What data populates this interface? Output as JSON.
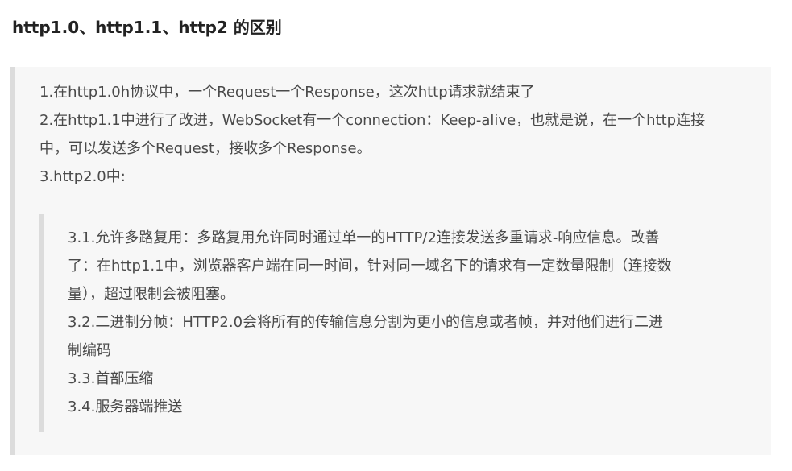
{
  "title": "http1.0、http1.1、http2 的区别",
  "outer_lines": [
    "1.在http1.0h协议中，一个Request一个Response，这次http请求就结束了",
    "2.在http1.1中进行了改进，WebSocket有一个connection：Keep-alive，也就是说，在一个http连接",
    "中，可以发送多个Request，接收多个Response。",
    "3.http2.0中:"
  ],
  "inner_lines": [
    "3.1.允许多路复用：多路复用允许同时通过单一的HTTP/2连接发送多重请求-响应信息。改善",
    "了：在http1.1中，浏览器客户端在同一时间，针对同一域名下的请求有一定数量限制（连接数",
    "量），超过限制会被阻塞。",
    "3.2.二进制分帧：HTTP2.0会将所有的传输信息分割为更小的信息或者帧，并对他们进行二进",
    "制编码",
    "3.3.首部压缩",
    "3.4.服务器端推送"
  ]
}
